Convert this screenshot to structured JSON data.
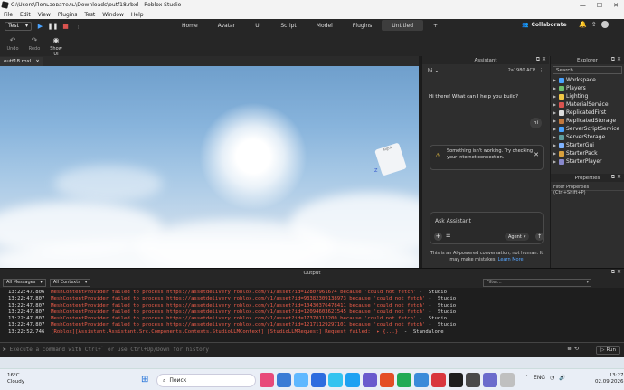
{
  "window": {
    "title": "C:\\Users\\Пользователь\\Downloads\\outf18.rbxl - Roblox Studio",
    "controls": [
      "—",
      "☐",
      "✕"
    ]
  },
  "menu": [
    "File",
    "Edit",
    "View",
    "Plugins",
    "Test",
    "Window",
    "Help"
  ],
  "toolbar": {
    "mode": "Test",
    "tabs": [
      "Home",
      "Avatar",
      "UI",
      "Script",
      "Model",
      "Plugins",
      "Untitled"
    ],
    "active_tab": "Untitled",
    "collaborate": "Collaborate"
  },
  "subtoolbar": {
    "undo": "Undo",
    "redo": "Redo",
    "show_ui": "Show UI"
  },
  "document_tab": {
    "label": "outf18.rbxl",
    "close": "×"
  },
  "viewport": {
    "gizmo_label": "Right",
    "axis_z": "Z"
  },
  "assistant": {
    "header": "Assistant",
    "agent_name": "hi",
    "top_right": "2a1980  ACP",
    "greeting": "Hi there! What can I help you build?",
    "user_message": "hi",
    "warning": "Something isn't working. Try checking your internet connection.",
    "input_placeholder": "Ask Assistant",
    "mode": "Agent",
    "disclaimer": "This is an AI-powered conversation, not human. It may make mistakes.",
    "learn_more": "Learn More"
  },
  "explorer": {
    "header": "Explorer",
    "search_placeholder": "Search",
    "items": [
      {
        "label": "Workspace",
        "color": "#4aa3ff"
      },
      {
        "label": "Players",
        "color": "#6ec06e"
      },
      {
        "label": "Lighting",
        "color": "#f2c744"
      },
      {
        "label": "MaterialService",
        "color": "#d9534f"
      },
      {
        "label": "ReplicatedFirst",
        "color": "#dddddd"
      },
      {
        "label": "ReplicatedStorage",
        "color": "#c2783d"
      },
      {
        "label": "ServerScriptService",
        "color": "#4aa3ff"
      },
      {
        "label": "ServerStorage",
        "color": "#5f9ea0"
      },
      {
        "label": "StarterGui",
        "color": "#7fb3ff"
      },
      {
        "label": "StarterPack",
        "color": "#d8a03d"
      },
      {
        "label": "StarterPlayer",
        "color": "#8888cc"
      }
    ]
  },
  "properties": {
    "header": "Properties",
    "filter_placeholder": "Filter Properties (Ctrl+Shift+P)"
  },
  "output": {
    "header": "Output",
    "filter_messages": "All Messages",
    "filter_contexts": "All Contexts",
    "filter_placeholder": "Filter...",
    "logs": [
      {
        "ts": "13:22:47.806",
        "msg": "MeshContentProvider failed to process https://assetdelivery.roblox.com/v1/asset?id=12807961674 because 'could not fetch'",
        "src": " -  Studio"
      },
      {
        "ts": "13:22:47.807",
        "msg": "MeshContentProvider failed to process https://assetdelivery.roblox.com/v1/asset?id=93382309138973 because 'could not fetch'",
        "src": " -  Studio"
      },
      {
        "ts": "13:22:47.807",
        "msg": "MeshContentProvider failed to process https://assetdelivery.roblox.com/v1/asset?id=10430376478411 because 'could not fetch'",
        "src": " -  Studio"
      },
      {
        "ts": "13:22:47.807",
        "msg": "MeshContentProvider failed to process https://assetdelivery.roblox.com/v1/asset?id=12094603621545 because 'could not fetch'",
        "src": " -  Studio"
      },
      {
        "ts": "13:22:47.807",
        "msg": "MeshContentProvider failed to process https://assetdelivery.roblox.com/v1/asset?id=17370113200 because 'could not fetch'",
        "src": " -  Studio"
      },
      {
        "ts": "13:22:47.807",
        "msg": "MeshContentProvider failed to process https://assetdelivery.roblox.com/v1/asset?id=12171129297101 because 'could not fetch'",
        "src": " -  Studio"
      },
      {
        "ts": "13:22:52.746",
        "msg": "[Roblox][Assistant.Assistant.Src.Components.Contexts.StudioLLMContext] [StudioLLMRequest] Request failed:  ▸ {...}",
        "src": "  -  Standalone"
      }
    ]
  },
  "command": {
    "placeholder": "Execute a command with Ctrl+` or use Ctrl+Up/Down for history",
    "run": "Run"
  },
  "taskbar": {
    "temp": "16°C",
    "condition": "Cloudy",
    "search": "Поиск",
    "apps": [
      "#e84a7a",
      "#3a7bd5",
      "#5fb8ff",
      "#2d6cdf",
      "#33c3f0",
      "#1da1f2",
      "#6a5acd",
      "#e44d26",
      "#22aa55",
      "#3b8bd9",
      "#d9363e",
      "#1e1e1e",
      "#4a4a4a",
      "#6b6bcc",
      "#c0c0c0"
    ],
    "lang": "ENG",
    "time": "13:27",
    "date": "02.09.2026"
  }
}
